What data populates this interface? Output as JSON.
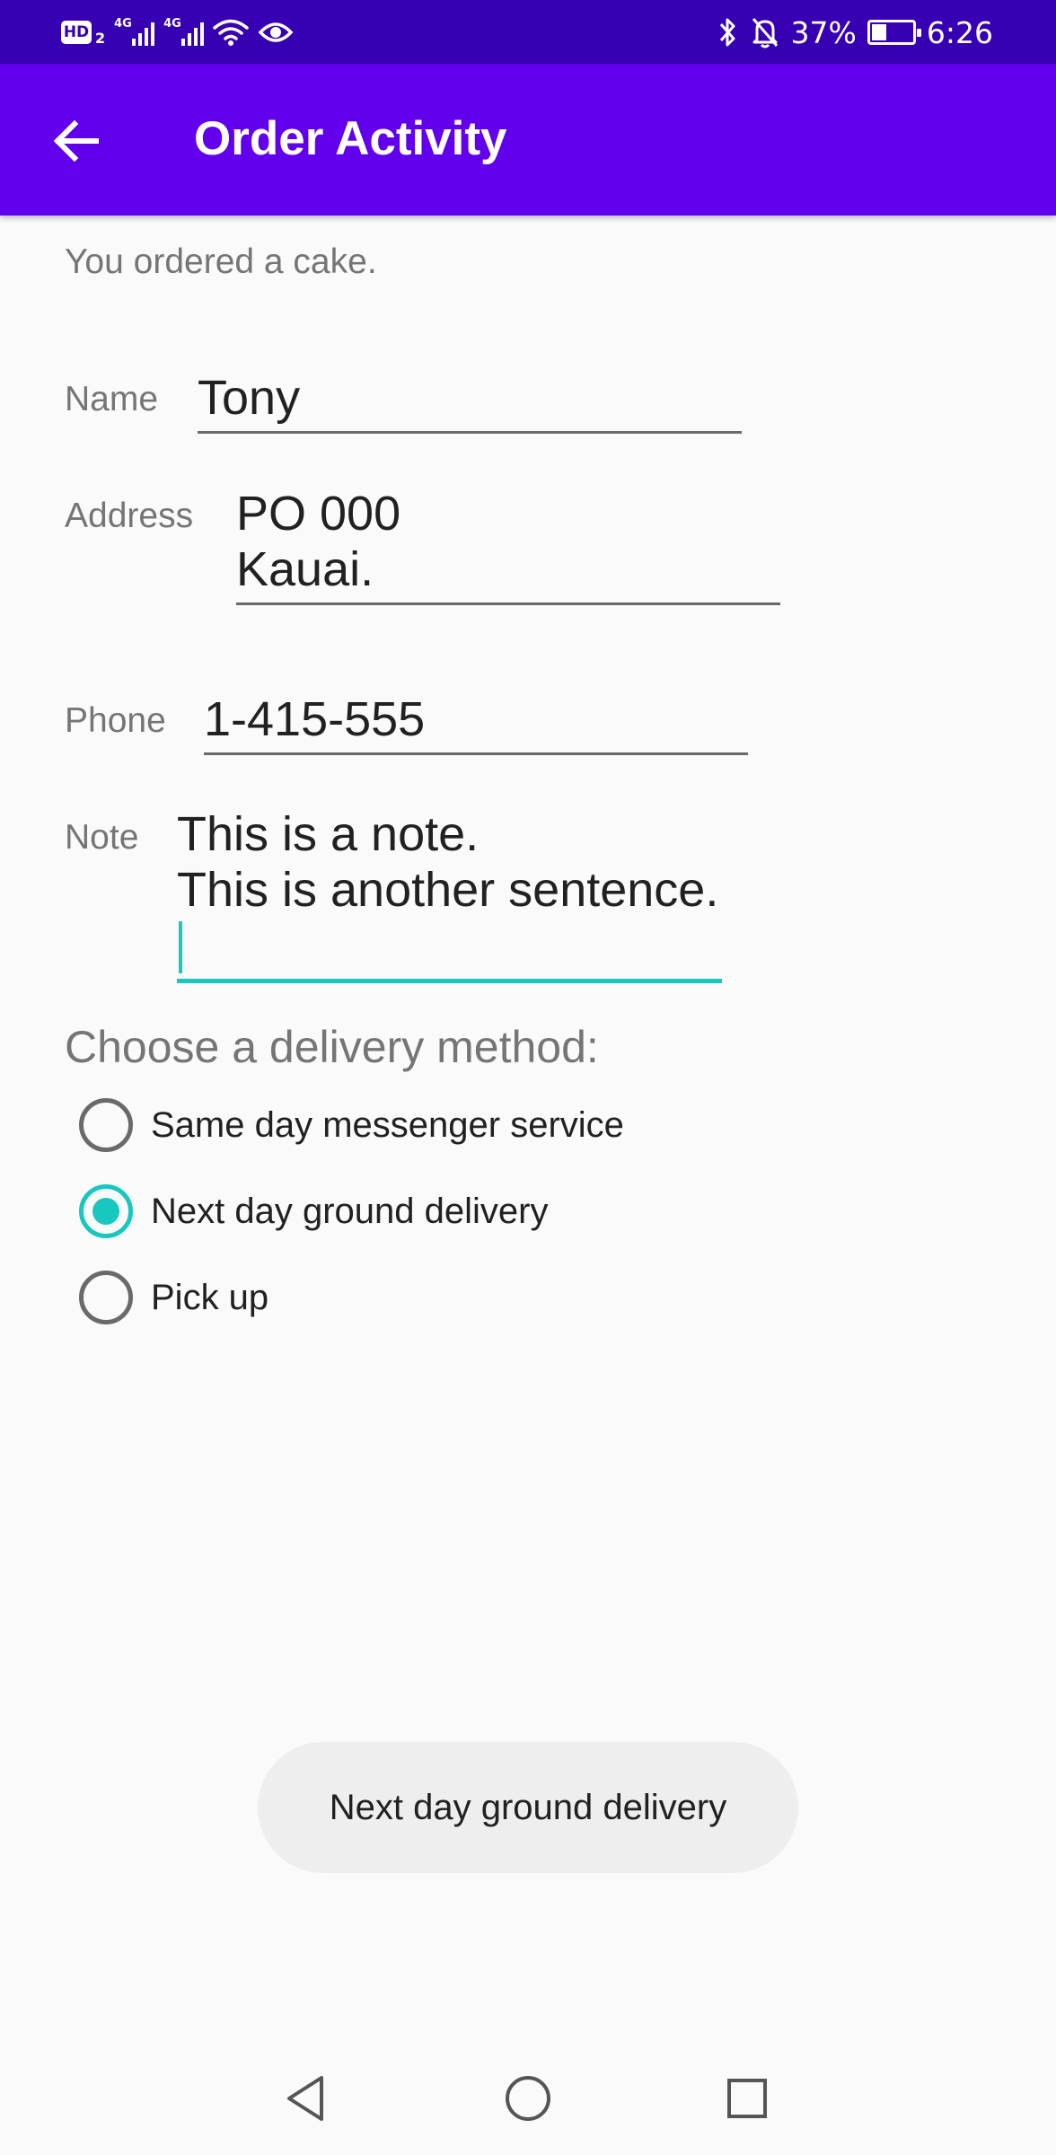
{
  "status_bar": {
    "hd_label": "HD",
    "hd_sub": "2",
    "sim1_label": "4G",
    "sim2_label": "4G",
    "battery_percent": "37%",
    "battery_level": 0.37,
    "time": "6:26"
  },
  "app_bar": {
    "title": "Order Activity"
  },
  "intro_text": "You ordered a cake.",
  "form": {
    "name": {
      "label": "Name",
      "value": "Tony"
    },
    "address": {
      "label": "Address",
      "value": "PO 000\nKauai."
    },
    "phone": {
      "label": "Phone",
      "value": "1-415-555"
    },
    "note": {
      "label": "Note",
      "value": "This is a note.\nThis is another sentence."
    }
  },
  "delivery": {
    "heading": "Choose a delivery method:",
    "options": [
      {
        "label": "Same day messenger service",
        "checked": false
      },
      {
        "label": "Next day ground delivery",
        "checked": true
      },
      {
        "label": "Pick up",
        "checked": false
      }
    ]
  },
  "toast": {
    "text": "Next day ground delivery"
  },
  "colors": {
    "status_bar": "#3700b3",
    "app_bar": "#6200ee",
    "accent": "#18c8bf"
  }
}
